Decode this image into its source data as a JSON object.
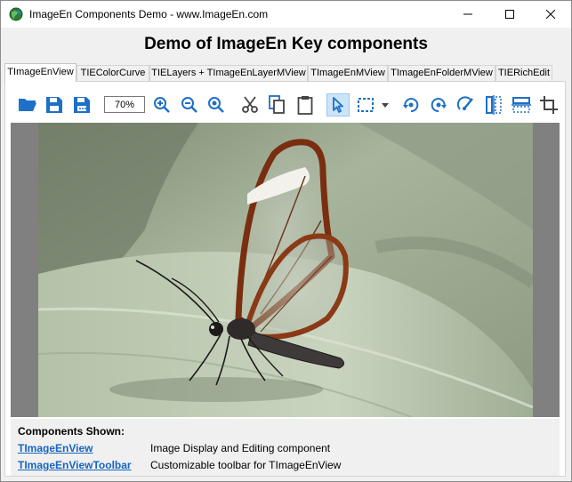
{
  "window": {
    "title": "ImageEn Components Demo - www.ImageEn.com"
  },
  "heading": "Demo of ImageEn Key components",
  "tabs": [
    {
      "label": "TImageEnView",
      "active": true
    },
    {
      "label": "TIEColorCurve"
    },
    {
      "label": "TIELayers + TImageEnLayerMView"
    },
    {
      "label": "TImageEnMView"
    },
    {
      "label": "TImageEnFolderMView"
    },
    {
      "label": "TIERichEdit"
    }
  ],
  "toolbar": {
    "zoom_value": "70%",
    "icons": [
      "open-folder-icon",
      "save-icon",
      "save-as-icon",
      "zoom-in-icon",
      "zoom-out-icon",
      "zoom-fit-icon",
      "cut-icon",
      "copy-icon",
      "paste-icon",
      "select-pointer-icon",
      "rect-select-icon",
      "rotate-left-icon",
      "rotate-right-icon",
      "magic-wand-icon",
      "flip-horizontal-icon",
      "flip-vertical-icon",
      "crop-icon"
    ]
  },
  "info": {
    "title": "Components Shown:",
    "components": [
      {
        "name": "TImageEnView",
        "description": "Image Display and Editing component"
      },
      {
        "name": "TImageEnViewToolbar",
        "description": "Customizable toolbar for TImageEnView"
      }
    ]
  },
  "colors": {
    "accent": "#1565c0",
    "selected_tool_bg": "#cce4f7"
  }
}
